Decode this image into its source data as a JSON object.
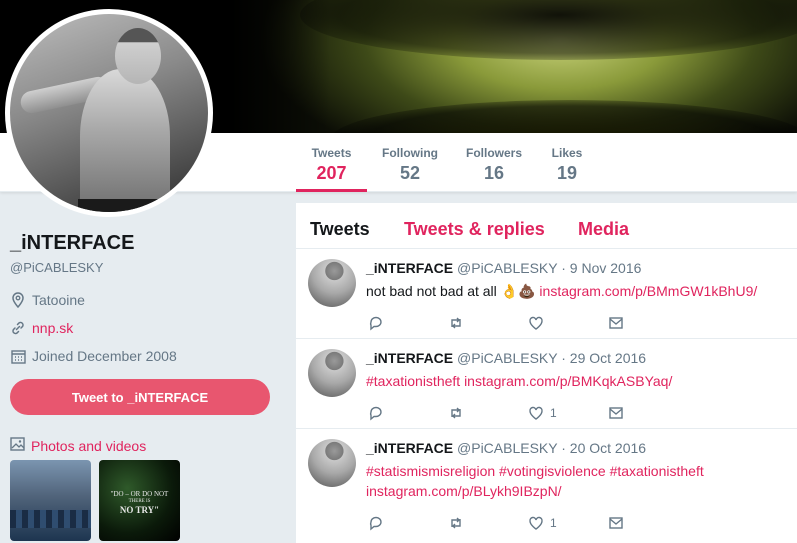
{
  "profile": {
    "name": "_iNTERFACE",
    "handle": "@PiCABLESKY",
    "location": "Tatooine",
    "website": "nnp.sk",
    "joined": "Joined December 2008",
    "tweet_to_label": "Tweet to _iNTERFACE",
    "photos_label": "Photos and videos",
    "thumb2_line1": "\"DO – OR DO NOT",
    "thumb2_line2": "THERE IS",
    "thumb2_line3": "NO TRY\""
  },
  "nav": [
    {
      "label": "Tweets",
      "value": "207"
    },
    {
      "label": "Following",
      "value": "52"
    },
    {
      "label": "Followers",
      "value": "16"
    },
    {
      "label": "Likes",
      "value": "19"
    }
  ],
  "timeline": {
    "tabs": [
      "Tweets",
      "Tweets & replies",
      "Media"
    ],
    "tweets": [
      {
        "name": "_iNTERFACE",
        "handle": "@PiCABLESKY",
        "date": "· 9 Nov 2016",
        "text": "not bad not bad at all 👌💩",
        "link": "instagram.com/p/BMmGW1kBhU9/",
        "likes": ""
      },
      {
        "name": "_iNTERFACE",
        "handle": "@PiCABLESKY",
        "date": "· 29 Oct 2016",
        "hashtag": "#taxationistheft",
        "link": "instagram.com/p/BMKqkASBYaq/",
        "likes": "1"
      },
      {
        "name": "_iNTERFACE",
        "handle": "@PiCABLESKY",
        "date": "· 20 Oct 2016",
        "hashtag1": "#statismismisreligion",
        "hashtag2": "#votingisviolence",
        "hashtag3": "#taxationistheft",
        "link": "instagram.com/p/BLykh9IBzpN/",
        "likes": "1"
      }
    ]
  },
  "colors": {
    "accent": "#e0245e",
    "button": "#e8566f",
    "muted": "#657786",
    "background": "#e6ecf0"
  }
}
